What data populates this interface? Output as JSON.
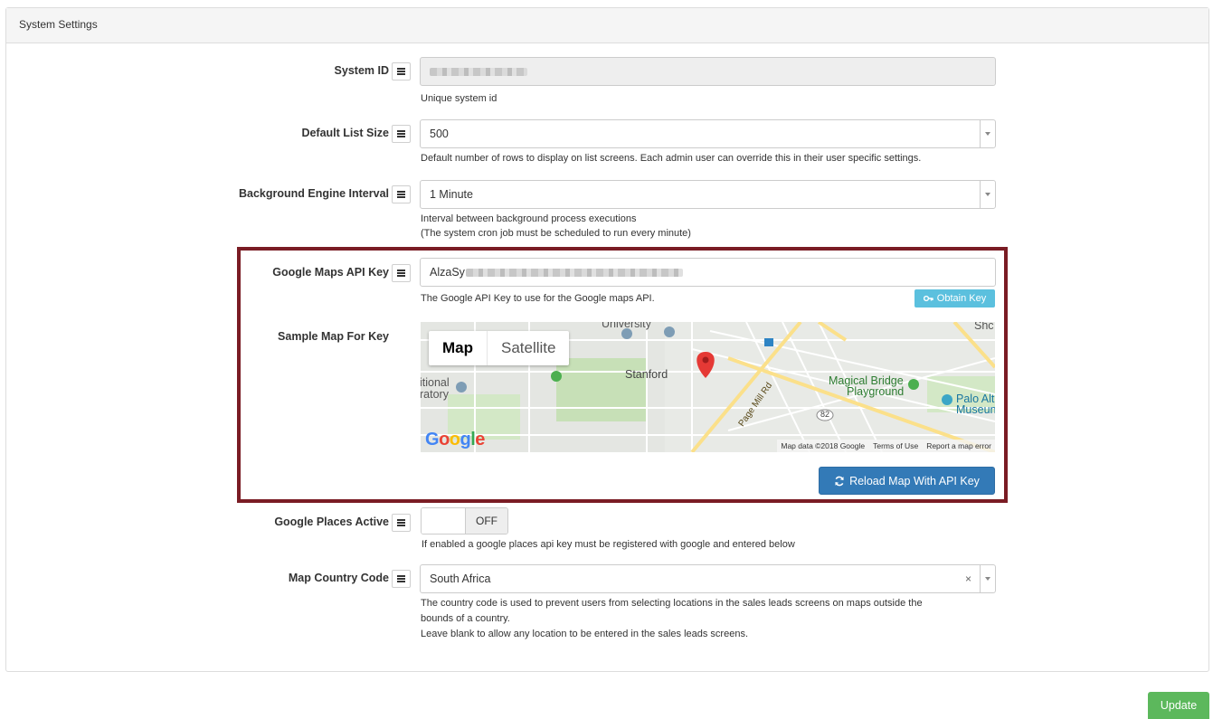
{
  "panel": {
    "title": "System Settings"
  },
  "fields": {
    "system_id": {
      "label": "System ID",
      "help": "Unique system id"
    },
    "default_list_size": {
      "label": "Default List Size",
      "value": "500",
      "help": "Default number of rows to display on list screens. Each admin user can override this in their user specific settings."
    },
    "background_engine_interval": {
      "label": "Background Engine Interval",
      "value": "1 Minute",
      "help_line1": "Interval between background process executions",
      "help_line2": "(The system cron job must be scheduled to run every minute)"
    },
    "google_maps_api_key": {
      "label": "Google Maps API Key",
      "value_prefix": "AlzaSy",
      "help": "The Google API Key to use for the Google maps API.",
      "obtain_label": "Obtain Key"
    },
    "sample_map": {
      "label": "Sample Map For Key",
      "map_tab": "Map",
      "satellite_tab": "Satellite",
      "places": {
        "stanford": "Stanford",
        "magical_bridge": "Magical Bridge",
        "playground": "Playground",
        "palo_alto": "Palo Alt",
        "museum": "Museun",
        "national": "itional",
        "oratory": "ratory",
        "page_mill": "Page Mill Rd",
        "university": "University",
        "shc": "Shc",
        "route": "82"
      },
      "footer": {
        "data": "Map data ©2018 Google",
        "terms": "Terms of Use",
        "report": "Report a map error"
      },
      "logo": "Google",
      "reload_label": "Reload Map With API Key"
    },
    "google_places_active": {
      "label": "Google Places Active",
      "state": "OFF",
      "help": "If enabled a google places api key must be registered with google and entered below"
    },
    "map_country_code": {
      "label": "Map Country Code",
      "value": "South Africa",
      "clear": "×",
      "help_line1": "The country code is used to prevent users from selecting locations in the sales leads screens on maps outside the",
      "help_line2": "bounds of a country.",
      "help_line3": "Leave blank to allow any location to be entered in the sales leads screens."
    }
  },
  "actions": {
    "update_label": "Update"
  },
  "colors": {
    "highlight": "#7a1c24",
    "primary": "#337ab7",
    "info": "#5bc0de",
    "success": "#5cb85c",
    "pin": "#e53935"
  }
}
